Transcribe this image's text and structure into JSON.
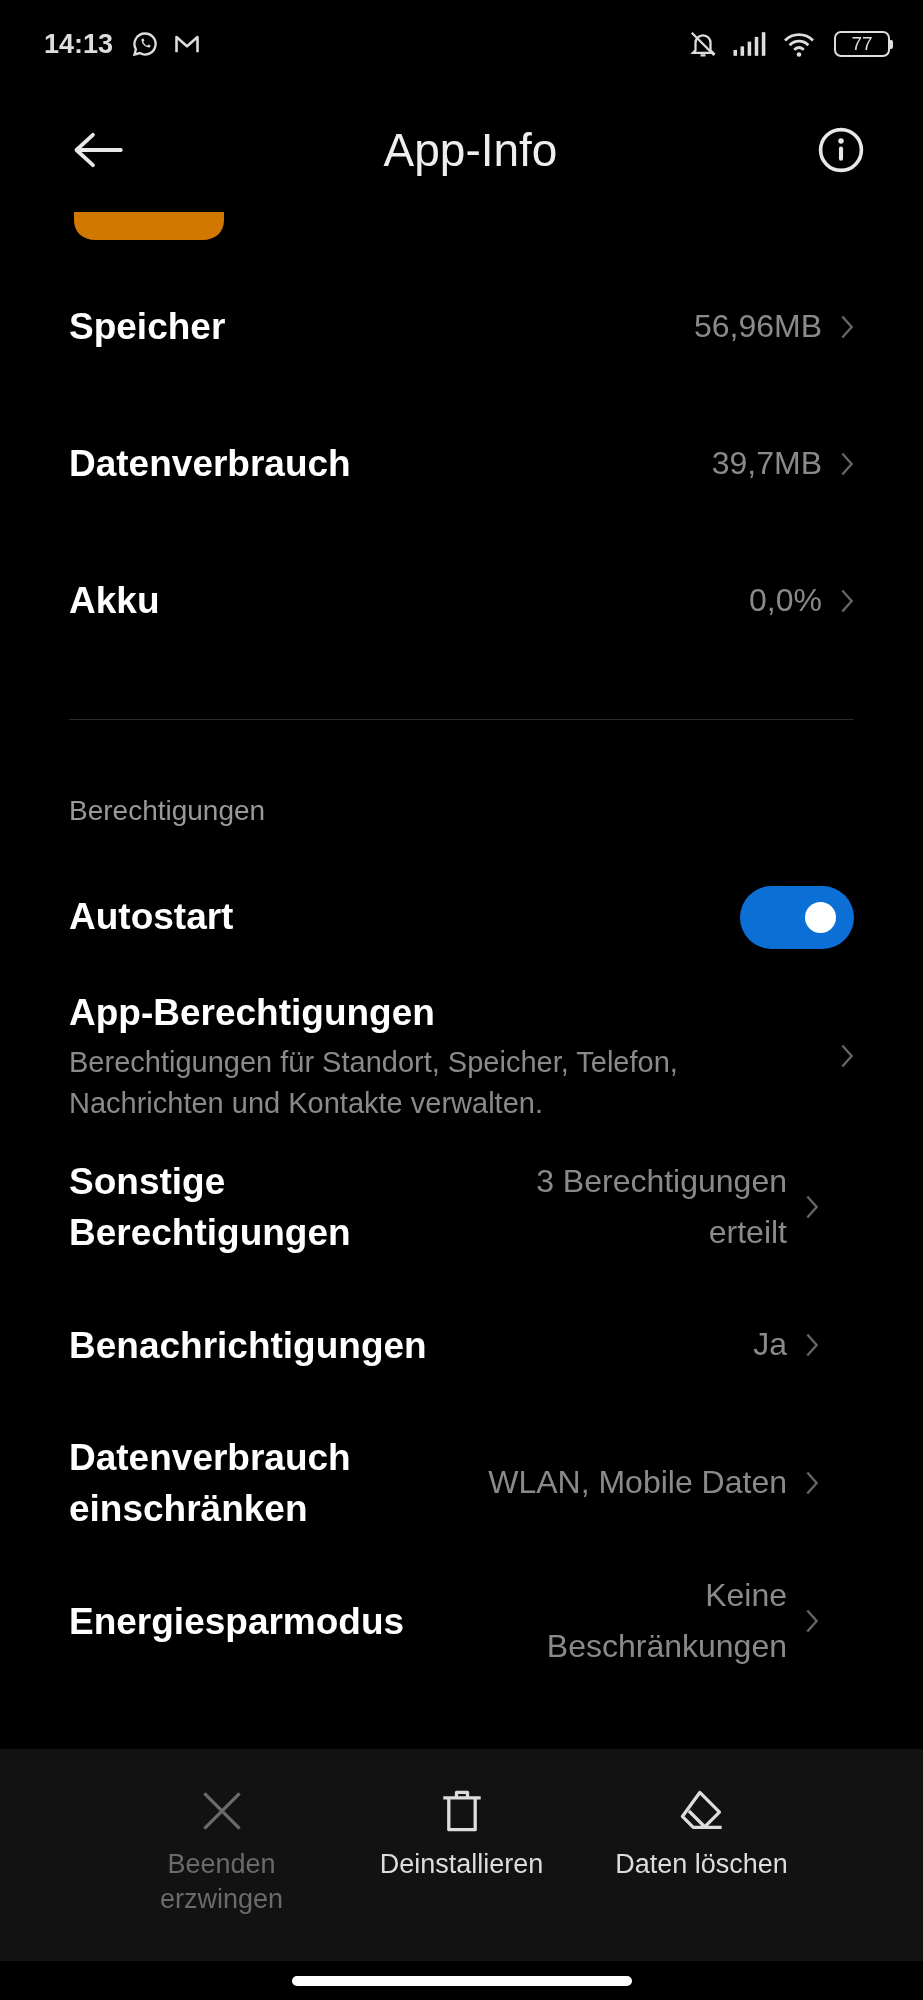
{
  "status_bar": {
    "time": "14:13",
    "battery": "77"
  },
  "header": {
    "title": "App-Info"
  },
  "info_rows": [
    {
      "title": "Speicher",
      "value": "56,96MB"
    },
    {
      "title": "Datenverbrauch",
      "value": "39,7MB"
    },
    {
      "title": "Akku",
      "value": "0,0%"
    }
  ],
  "section_title": "Berechtigungen",
  "permission_rows": [
    {
      "kind": "toggle",
      "title": "Autostart",
      "on": true
    },
    {
      "kind": "detail",
      "title": "App-Berechtigungen",
      "subtitle": "Berechtigungen für Standort, Speicher, Telefon, Nachrichten und Kontakte verwalten."
    },
    {
      "kind": "value",
      "title": "Sonstige Berechtigungen",
      "value": "3 Berechtigungen erteilt"
    },
    {
      "kind": "value",
      "title": "Benachrichtigungen",
      "value": "Ja"
    },
    {
      "kind": "value",
      "title": "Datenverbrauch einschränken",
      "value": "WLAN, Mobile Daten"
    },
    {
      "kind": "value",
      "title": "Energiesparmodus",
      "value": "Keine Beschränkungen"
    }
  ],
  "actions": [
    {
      "kind": "stop",
      "label": "Beenden erzwingen",
      "disabled": true
    },
    {
      "kind": "uninstall",
      "label": "Deinstallieren",
      "disabled": false
    },
    {
      "kind": "clear",
      "label": "Daten löschen",
      "disabled": false
    }
  ]
}
